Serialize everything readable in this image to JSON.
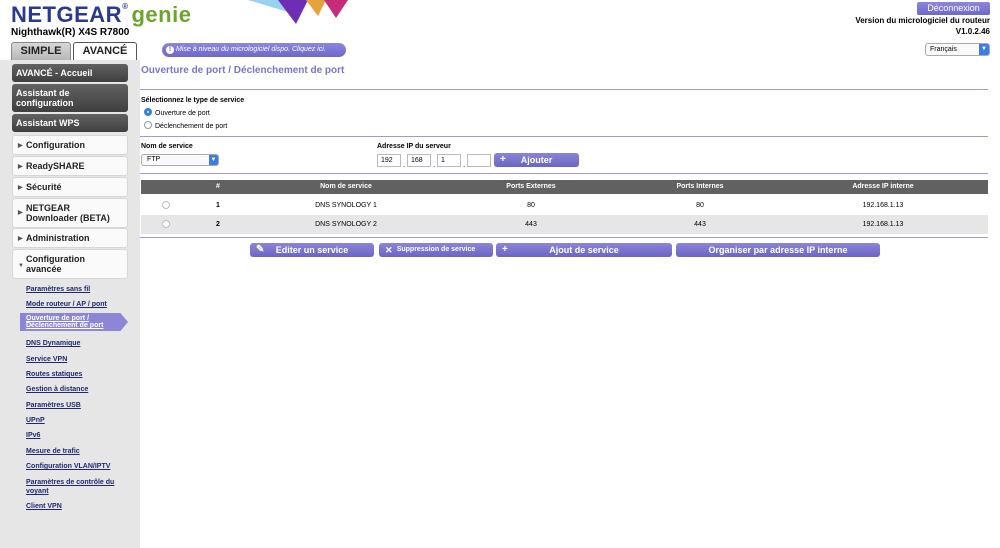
{
  "header": {
    "brand_netgear": "NETGEAR",
    "brand_reg": "®",
    "brand_genie": "genie",
    "model": "Nighthawk(R) X4S R7800",
    "logout_label": "Déconnexion",
    "firmware_label": "Version du micrologiciel du routeur",
    "firmware_version": "V1.0.2.46",
    "notice": "Mise à niveau du micrologiciel dispo. Cliquez ici.",
    "language": "Français"
  },
  "tabs": {
    "simple": "SIMPLE",
    "advanced": "AVANCÉ"
  },
  "sidebar": {
    "main_items": [
      "AVANCÉ - Accueil",
      "Assistant de configuration",
      "Assistant WPS"
    ],
    "sections": [
      "Configuration",
      "ReadySHARE",
      "Sécurité",
      "NETGEAR Downloader (BETA)",
      "Administration",
      "Configuration avancée"
    ],
    "sublinks": [
      "Paramètres sans fil",
      "Mode routeur / AP / pont",
      "Ouverture de port / Déclenchement de port",
      "DNS Dynamique",
      "Service VPN",
      "Routes statiques",
      "Gestion à distance",
      "Paramètres USB",
      "UPnP",
      "IPv6",
      "Mesure de trafic",
      "Configuration VLAN/IPTV",
      "Paramètres de contrôle du voyant",
      "Client VPN"
    ]
  },
  "main": {
    "title": "Ouverture de port / Déclenchement de port",
    "service_type_label": "Sélectionnez le type de service",
    "option_forwarding": "Ouverture de port",
    "option_triggering": "Déclenchement de port",
    "service_name_label": "Nom de service",
    "service_name_value": "FTP",
    "server_ip_label": "Adresse IP du serveur",
    "ip": [
      "192",
      "168",
      "1",
      ""
    ],
    "add_button": "Ajouter",
    "table": {
      "headers": [
        "#",
        "Nom de service",
        "Ports Externes",
        "Ports Internes",
        "Adresse IP interne"
      ],
      "rows": [
        {
          "num": "1",
          "name": "DNS SYNOLOGY 1",
          "ext": "80",
          "int": "80",
          "ip": "192.168.1.13"
        },
        {
          "num": "2",
          "name": "DNS SYNOLOGY 2",
          "ext": "443",
          "int": "443",
          "ip": "192.168.1.13"
        }
      ]
    },
    "actions": {
      "edit": "Editer un service",
      "delete": "Suppression de service",
      "add_service": "Ajout de service",
      "sort": "Organiser par adresse IP interne"
    }
  }
}
